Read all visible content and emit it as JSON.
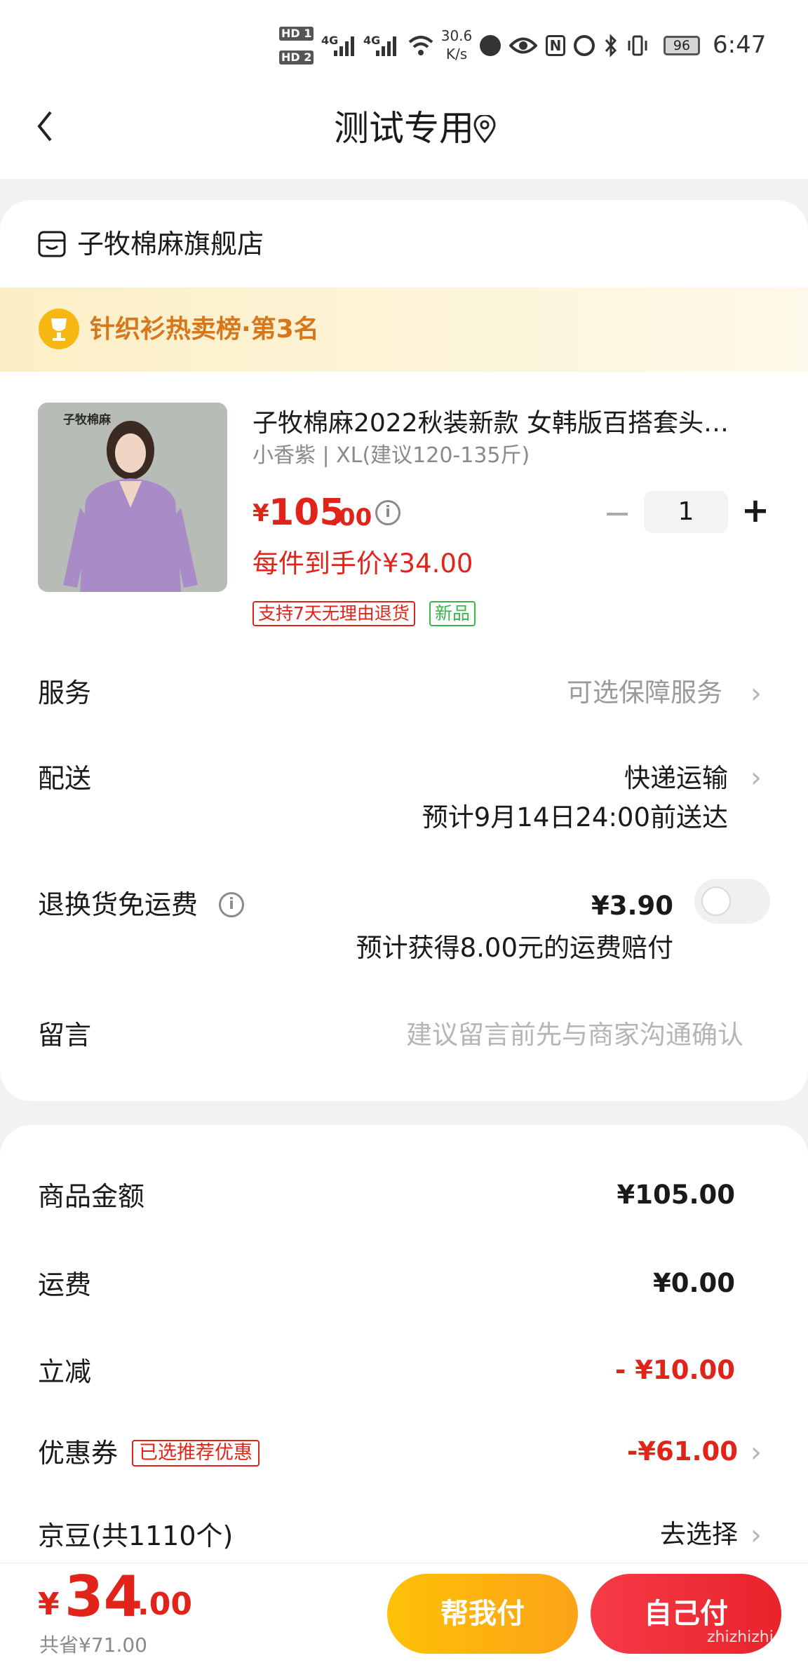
{
  "status_bar": {
    "hd1": "HD 1",
    "hd2": "HD 2",
    "net1": "4G",
    "net2": "4G",
    "speed_value": "30.6",
    "speed_unit": "K/s",
    "battery": "96",
    "time": "6:47"
  },
  "header": {
    "back_icon": "chevron-left-icon",
    "title": "测试专用",
    "location_icon": "location-pin-icon"
  },
  "shop": {
    "name": "子牧棉麻旗舰店",
    "rank_text": "针织衫热卖榜·第3名"
  },
  "product": {
    "image_brand_text": "子牧棉麻",
    "title": "子牧棉麻2022秋装新款 女韩版百搭套头…",
    "spec": "小香紫 | XL(建议120-135斤)",
    "price_symbol": "¥",
    "price_int": "105",
    "price_dec": ".00",
    "per_price": "每件到手价¥34.00",
    "quantity": "1",
    "tags": [
      "支持7天无理由退货",
      "新品"
    ]
  },
  "options": {
    "service_label": "服务",
    "service_value": "可选保障服务",
    "delivery_label": "配送",
    "delivery_value": "快递运输",
    "delivery_eta": "预计9月14日24:00前送达",
    "return_label": "退换货免运费",
    "return_price": "¥3.90",
    "return_note": "预计获得8.00元的运费赔付",
    "message_label": "留言",
    "message_placeholder": "建议留言前先与商家沟通确认"
  },
  "summary": {
    "goods_label": "商品金额",
    "goods_value": "¥105.00",
    "shipping_label": "运费",
    "shipping_value": "¥0.00",
    "discount_label": "立减",
    "discount_value": "- ¥10.00",
    "coupon_label": "优惠券",
    "coupon_tag": "已选推荐优惠",
    "coupon_value": "-¥61.00",
    "jd_label": "京豆(共1110个)",
    "jd_value": "去选择"
  },
  "footer": {
    "total_symbol": "¥",
    "total_int": "34",
    "total_dec": ".00",
    "saved": "共省¥71.00",
    "help_pay": "帮我付",
    "self_pay": "自己付",
    "watermark": "zhizhizhi.com"
  },
  "colors": {
    "accent_red": "#e2231a",
    "rank_orange": "#d7771b",
    "help_button": "#fba318",
    "tag_green": "#3ab54a"
  }
}
